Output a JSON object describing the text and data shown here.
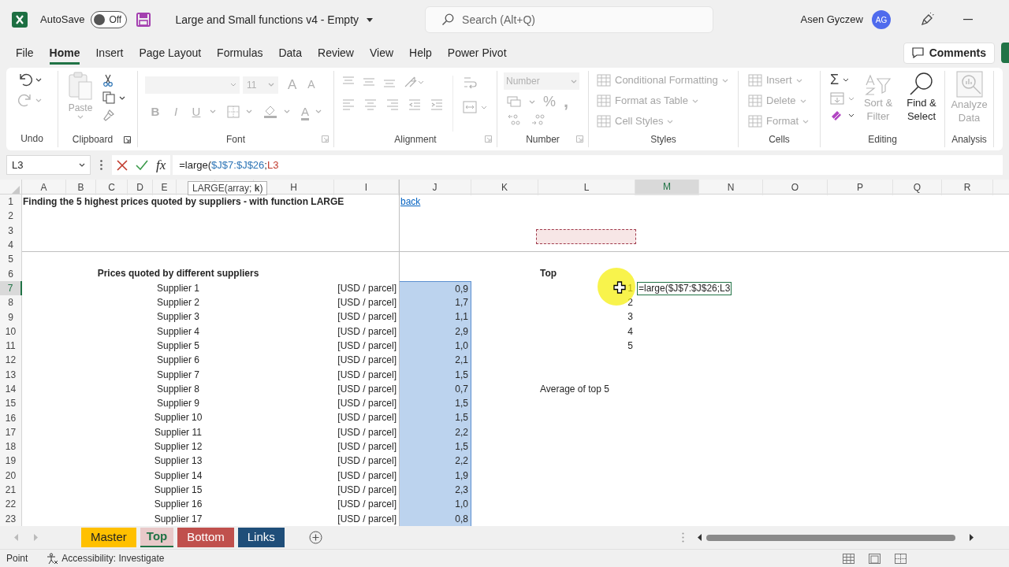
{
  "title_bar": {
    "autosave_label": "AutoSave",
    "autosave": {
      "on": false,
      "label": "Off"
    },
    "document_title": "Large and Small functions v4 - Empty",
    "search": {
      "placeholder": "Search (Alt+Q)"
    },
    "user_name": "Asen Gyczew",
    "avatar": "AG"
  },
  "ribbon_tabs": [
    {
      "label": "File",
      "selected": false
    },
    {
      "label": "Home",
      "selected": true
    },
    {
      "label": "Insert",
      "selected": false
    },
    {
      "label": "Page Layout",
      "selected": false
    },
    {
      "label": "Formulas",
      "selected": false
    },
    {
      "label": "Data",
      "selected": false
    },
    {
      "label": "Review",
      "selected": false
    },
    {
      "label": "View",
      "selected": false
    },
    {
      "label": "Help",
      "selected": false
    },
    {
      "label": "Power Pivot",
      "selected": false
    }
  ],
  "comments_button": "Comments",
  "ribbon": {
    "undo": {
      "label": "Undo",
      "redo": {
        "disabled": true
      }
    },
    "clipboard": {
      "label": "Clipboard",
      "paste": {
        "label": "Paste",
        "disabled": true
      }
    },
    "font": {
      "label": "Font",
      "disabled": true,
      "size": "11",
      "grow": "A",
      "shrink": "A",
      "styles": [
        "B",
        "I",
        "U"
      ],
      "font_color": "A"
    },
    "alignment": {
      "label": "Alignment",
      "disabled": true
    },
    "number": {
      "label": "Number",
      "disabled": true,
      "format": "Number",
      "percent": "%",
      "comma": ","
    },
    "styles": {
      "label": "Styles",
      "commands": [
        {
          "label": "Conditional Formatting",
          "disabled": true
        },
        {
          "label": "Format as Table",
          "disabled": true
        },
        {
          "label": "Cell Styles",
          "disabled": true
        }
      ]
    },
    "cells": {
      "label": "Cells",
      "commands": [
        {
          "label": "Insert",
          "disabled": true
        },
        {
          "label": "Delete",
          "disabled": true
        },
        {
          "label": "Format",
          "disabled": true
        }
      ]
    },
    "editing": {
      "label": "Editing",
      "sum": "Σ",
      "sort_filter": {
        "label": "Sort & Filter",
        "disabled": true
      },
      "find_select": {
        "label": "Find & Select",
        "disabled": false
      }
    },
    "analysis": {
      "label": "Analysis",
      "analyze_data": {
        "label": "Analyze Data",
        "disabled": true
      }
    }
  },
  "formula_bar": {
    "name_box": "L3",
    "function_button": "fx",
    "formula": [
      {
        "text": "=large(",
        "color": "#262626"
      },
      {
        "text": "$J$7:$J$26",
        "color": "#2e75b6"
      },
      {
        "text": ";",
        "color": "#262626"
      },
      {
        "text": "L3",
        "color": "#c0392b"
      }
    ]
  },
  "function_tooltip": "LARGE(array; **k**)",
  "columns": [
    {
      "label": "A",
      "selected": false
    },
    {
      "label": "B",
      "selected": false
    },
    {
      "label": "C",
      "selected": false
    },
    {
      "label": "D",
      "selected": false
    },
    {
      "label": "E",
      "selected": false
    },
    {
      "selected": false
    },
    {
      "selected": false
    },
    {
      "label": "H",
      "selected": false
    },
    {
      "label": "I",
      "selected": false
    },
    {
      "label": "J",
      "selected": false
    },
    {
      "label": "K",
      "selected": false
    },
    {
      "label": "L",
      "selected": false
    },
    {
      "label": "M",
      "selected": true
    },
    {
      "label": "N",
      "selected": false
    },
    {
      "label": "O",
      "selected": false
    },
    {
      "label": "P",
      "selected": false
    },
    {
      "label": "Q",
      "selected": false
    },
    {
      "label": "R",
      "selected": false
    }
  ],
  "rows": [
    {
      "number": "1",
      "selected": false
    },
    {
      "number": "2",
      "selected": false
    },
    {
      "number": "3",
      "selected": false
    },
    {
      "number": "4",
      "selected": false
    },
    {
      "number": "5",
      "selected": false
    },
    {
      "number": "6",
      "selected": false
    },
    {
      "number": "7",
      "selected": true
    },
    {
      "number": "8",
      "selected": false
    },
    {
      "number": "9",
      "selected": false
    },
    {
      "number": "10",
      "selected": false
    },
    {
      "number": "11",
      "selected": false
    },
    {
      "number": "12",
      "selected": false
    },
    {
      "number": "13",
      "selected": false
    },
    {
      "number": "14",
      "selected": false
    },
    {
      "number": "15",
      "selected": false
    },
    {
      "number": "16",
      "selected": false
    },
    {
      "number": "17",
      "selected": false
    },
    {
      "number": "18",
      "selected": false
    },
    {
      "number": "19",
      "selected": false
    },
    {
      "number": "20",
      "selected": false
    },
    {
      "number": "21",
      "selected": false
    },
    {
      "number": "22",
      "selected": false
    },
    {
      "number": "23",
      "selected": false
    }
  ],
  "sheet": {
    "title": "Finding the 5 highest prices quoted by suppliers - with function LARGE",
    "back_link": "back",
    "table_heading": "Prices quoted by different suppliers",
    "top_heading": "Top",
    "average_label": "Average of top 5",
    "editing_cell": "=large($J$7:$J$26;L3"
  },
  "suppliers": [
    {
      "name": "Supplier 1",
      "unit": "[USD / parcel]",
      "price": "0,9"
    },
    {
      "name": "Supplier 2",
      "unit": "[USD / parcel]",
      "price": "1,7"
    },
    {
      "name": "Supplier 3",
      "unit": "[USD / parcel]",
      "price": "1,1"
    },
    {
      "name": "Supplier 4",
      "unit": "[USD / parcel]",
      "price": "2,9"
    },
    {
      "name": "Supplier 5",
      "unit": "[USD / parcel]",
      "price": "1,0"
    },
    {
      "name": "Supplier 6",
      "unit": "[USD / parcel]",
      "price": "2,1"
    },
    {
      "name": "Supplier 7",
      "unit": "[USD / parcel]",
      "price": "1,5"
    },
    {
      "name": "Supplier 8",
      "unit": "[USD / parcel]",
      "price": "0,7"
    },
    {
      "name": "Supplier 9",
      "unit": "[USD / parcel]",
      "price": "1,5"
    },
    {
      "name": "Supplier 10",
      "unit": "[USD / parcel]",
      "price": "1,5"
    },
    {
      "name": "Supplier 11",
      "unit": "[USD / parcel]",
      "price": "2,2"
    },
    {
      "name": "Supplier 12",
      "unit": "[USD / parcel]",
      "price": "1,5"
    },
    {
      "name": "Supplier 13",
      "unit": "[USD / parcel]",
      "price": "2,2"
    },
    {
      "name": "Supplier 14",
      "unit": "[USD / parcel]",
      "price": "1,9"
    },
    {
      "name": "Supplier 15",
      "unit": "[USD / parcel]",
      "price": "2,3"
    },
    {
      "name": "Supplier 16",
      "unit": "[USD / parcel]",
      "price": "1,0"
    },
    {
      "name": "Supplier 17",
      "unit": "[USD / parcel]",
      "price": "0,8"
    }
  ],
  "ranks": [
    "1",
    "2",
    "3",
    "4",
    "5"
  ],
  "sheet_tabs": [
    {
      "label": "Master",
      "color": "#ffc000",
      "selected": false
    },
    {
      "label": "Top",
      "color": "#e8c9c9",
      "selected": true
    },
    {
      "label": "Bottom",
      "color": "#c0504d",
      "selected": false
    },
    {
      "label": "Links",
      "color": "#1f4e79",
      "selected": false
    }
  ],
  "status_bar": {
    "mode": "Point",
    "accessibility": "Accessibility: Investigate"
  }
}
